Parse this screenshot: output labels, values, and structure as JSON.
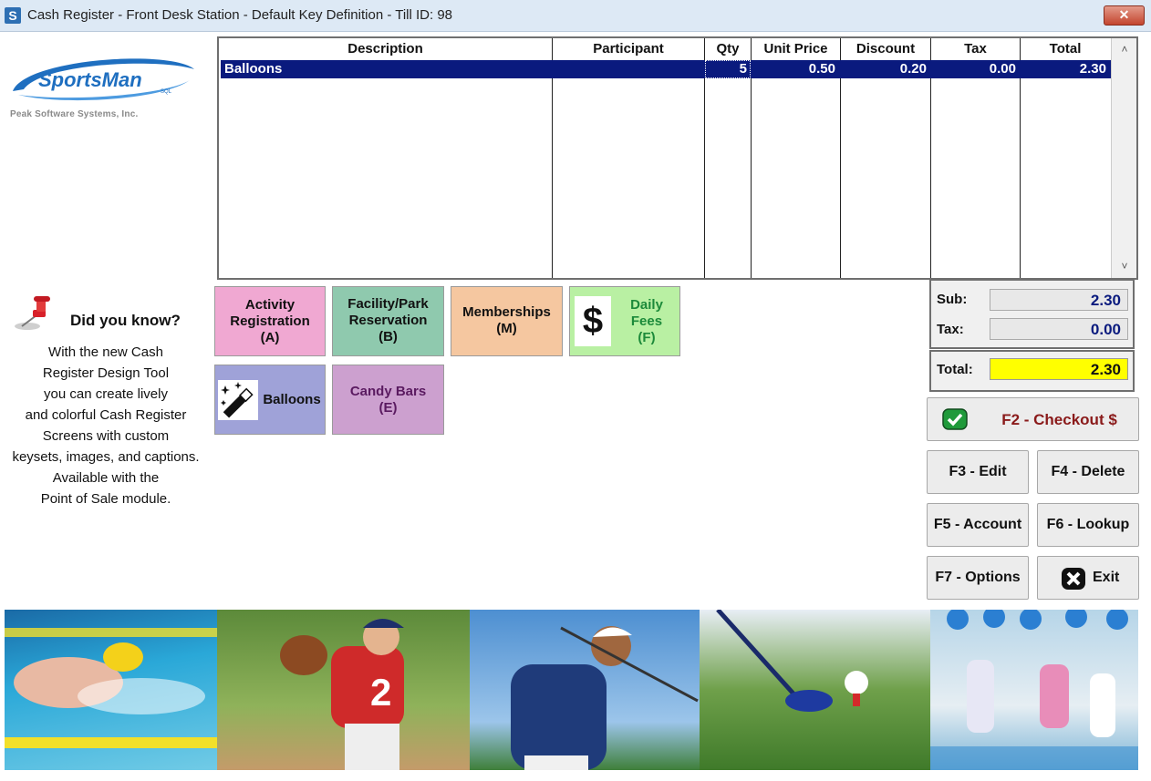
{
  "window": {
    "title": "Cash Register - Front Desk Station - Default Key Definition - Till ID: 98",
    "app_icon_letter": "S",
    "close_glyph": "✕"
  },
  "logo": {
    "name": "SportsMan",
    "mark": "SQL",
    "company": "Peak Software Systems, Inc."
  },
  "grid": {
    "columns": [
      "Description",
      "Participant",
      "Qty",
      "Unit Price",
      "Discount",
      "Tax",
      "Total"
    ],
    "rows": [
      {
        "description": "Balloons",
        "participant": "",
        "qty": "5",
        "unit_price": "0.50",
        "discount": "0.20",
        "tax": "0.00",
        "total": "2.30"
      }
    ],
    "scroll_up": "˄",
    "scroll_down": "˅"
  },
  "keys": [
    {
      "label_lines": [
        "Activity",
        "Registration",
        "(A)"
      ],
      "color": "#f0a8d2",
      "text_color": "#111111"
    },
    {
      "label_lines": [
        "Facility/Park",
        "Reservation",
        "(B)"
      ],
      "color": "#8fc9ae",
      "text_color": "#111111"
    },
    {
      "label_lines": [
        "Memberships",
        "(M)"
      ],
      "color": "#f5c7a0",
      "text_color": "#111111"
    },
    {
      "label_lines": [
        "Daily",
        "Fees",
        "(F)"
      ],
      "color": "#b9f0a3",
      "text_color": "#1c8a3a",
      "icon": "dollar-icon",
      "icon_glyph": "$"
    },
    {
      "label_lines": [
        "Balloons"
      ],
      "color": "#9fa2d8",
      "text_color": "#111111",
      "icon": "magic-wand-icon"
    },
    {
      "label_lines": [
        "Candy Bars",
        "(E)"
      ],
      "color": "#cca0cf",
      "text_color": "#5a1a60"
    }
  ],
  "totals": {
    "sub_label": "Sub:",
    "sub_value": "2.30",
    "tax_label": "Tax:",
    "tax_value": "0.00",
    "total_label": "Total:",
    "total_value": "2.30",
    "total_bg": "#ffff00"
  },
  "buttons": {
    "checkout": "F2 - Checkout $",
    "edit": "F3 - Edit",
    "delete": "F4 - Delete",
    "account": "F5 - Account",
    "lookup": "F6 - Lookup",
    "options": "F7 - Options",
    "exit": "Exit"
  },
  "did_you_know": {
    "heading": "Did you know?",
    "lines": [
      "With the new Cash",
      "Register Design Tool",
      "you can create lively",
      "and colorful Cash Register",
      "Screens with custom",
      "keysets, images, and captions.",
      "Available with the",
      "Point of Sale module."
    ]
  },
  "photos": [
    "swimmer",
    "baseball-pitcher",
    "golfer",
    "golf-ball",
    "fitness-class"
  ]
}
